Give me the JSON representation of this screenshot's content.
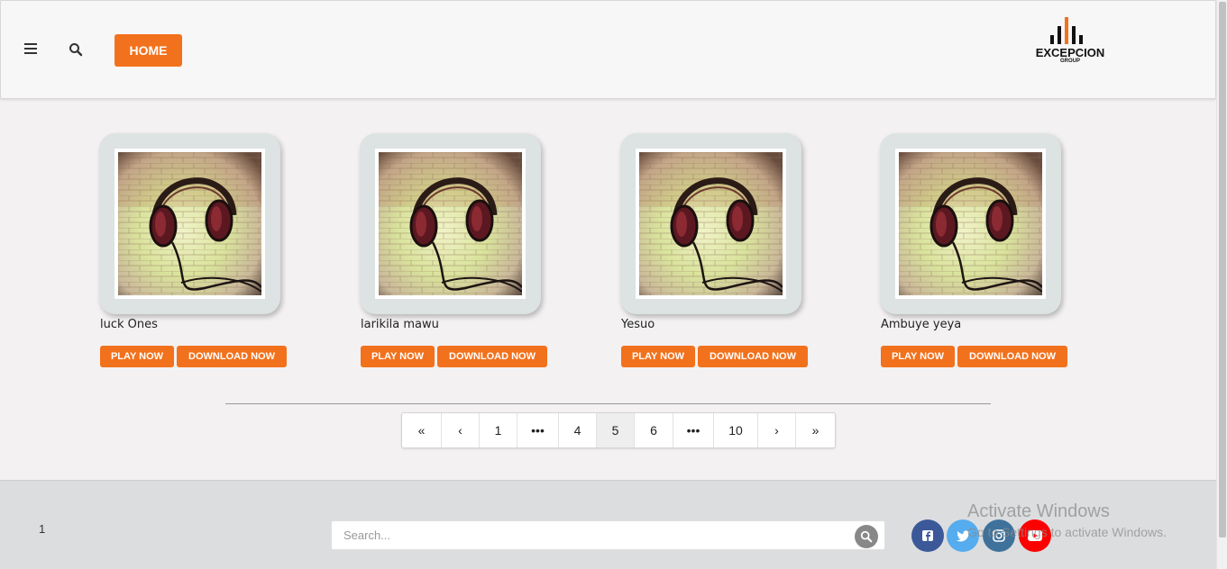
{
  "header": {
    "home_label": "HOME",
    "logo": {
      "name": "EXCEPCION",
      "sub": "GROUP"
    }
  },
  "songs": [
    {
      "title": "luck Ones",
      "play": "PLAY NOW",
      "download": "DOWNLOAD NOW"
    },
    {
      "title": "larikila mawu",
      "play": "PLAY NOW",
      "download": "DOWNLOAD NOW"
    },
    {
      "title": "Yesuo",
      "play": "PLAY NOW",
      "download": "DOWNLOAD NOW"
    },
    {
      "title": "Ambuye yeya",
      "play": "PLAY NOW",
      "download": "DOWNLOAD NOW"
    }
  ],
  "pagination": {
    "items": [
      "«",
      "‹",
      "1",
      "•••",
      "4",
      "5",
      "6",
      "•••",
      "10",
      "›",
      "»"
    ],
    "active": "5"
  },
  "footer": {
    "page_number": "1",
    "search_placeholder": "Search...",
    "social": [
      "facebook-icon",
      "twitter-icon",
      "instagram-icon",
      "youtube-icon"
    ]
  },
  "watermark": {
    "title": "Activate Windows",
    "subtitle": "Go to Settings to activate Windows."
  },
  "colors": {
    "accent": "#f2711c",
    "facebook": "#3b5998",
    "twitter": "#55acee",
    "instagram": "#3f729b",
    "youtube": "#ff0000"
  }
}
